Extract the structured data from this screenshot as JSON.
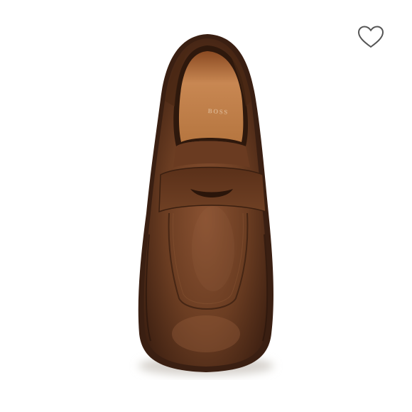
{
  "product": {
    "image_icon": "loafer-shoe-top-view",
    "brand_stamp": "BOSS",
    "colors": {
      "leather": "#6b3d22",
      "leather_dark": "#3f2112",
      "lining": "#c88752",
      "sole": "#3a1f12"
    }
  },
  "actions": {
    "wishlist_icon": "heart-outline-icon"
  }
}
